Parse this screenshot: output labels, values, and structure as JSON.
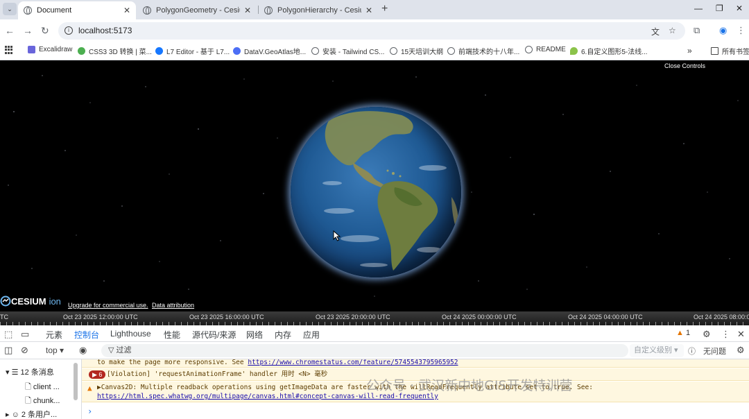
{
  "browser": {
    "tabs": [
      {
        "title": "Document",
        "active": true
      },
      {
        "title": "PolygonGeometry - Cesium D",
        "active": false
      },
      {
        "title": "PolygonHierarchy - Cesium D",
        "active": false
      }
    ],
    "url": "localhost:5173"
  },
  "bookmarks": [
    {
      "label": "Excalidraw",
      "color": "#6965db"
    },
    {
      "label": "CSS3 3D 转换 | 菜...",
      "color": "#4caf50"
    },
    {
      "label": "L7 Editor - 基于 L7...",
      "color": "#1677ff"
    },
    {
      "label": "DataV.GeoAtlas地...",
      "color": "#4c6ef5"
    },
    {
      "label": "安装 - Tailwind CS...",
      "color": "#5f6368"
    },
    {
      "label": "15天培训大纲",
      "color": "#5f6368"
    },
    {
      "label": "前端技术的十八年...",
      "color": "#5f6368"
    },
    {
      "label": "README",
      "color": "#5f6368"
    },
    {
      "label": "6.自定义图形5-法线...",
      "color": "#8bc34a"
    }
  ],
  "bookmarks_all_label": "所有书签",
  "cesium": {
    "close_controls": "Close Controls",
    "logo_text": "CESIUM",
    "logo_sub": "ion",
    "upgrade_link": "Upgrade for commercial use.",
    "attribution_link": "Data attribution"
  },
  "timeline": {
    "labels": [
      "TC",
      "Oct 23 2025 12:00:00 UTC",
      "Oct 23 2025 16:00:00 UTC",
      "Oct 23 2025 20:00:00 UTC",
      "Oct 24 2025 00:00:00 UTC",
      "Oct 24 2025 04:00:00 UTC",
      "Oct 24 2025 08:00:00"
    ]
  },
  "devtools": {
    "tabs": [
      "元素",
      "控制台",
      "Lighthouse",
      "性能",
      "源代码/来源",
      "网络",
      "内存",
      "应用"
    ],
    "active_tab": "控制台",
    "issues_count": "1",
    "context": "top",
    "filter_placeholder": "过滤",
    "levels_label": "自定义级别",
    "no_issues": "无问题",
    "sidebar": {
      "messages": "12 条消息",
      "items": [
        "client ...",
        "chunk..."
      ],
      "user_messages": "2 条用户..."
    },
    "console": {
      "line1": "to make the page more responsive. See ",
      "line1_link": "https://www.chromestatus.com/feature/5745543795965952",
      "violation_count": "6",
      "violation": "[Violation] 'requestAnimationFrame' handler 用时 <N> 毫秒",
      "warning": "▶Canvas2D: Multiple readback operations using getImageData are faster with the willReadFrequently attribute set to true. See:",
      "warning_link": "https://html.spec.whatwg.org/multipage/canvas.html#concept-canvas-will-read-frequently"
    }
  },
  "watermark": "公众号 · 武汉新中地GIS开发特训营"
}
